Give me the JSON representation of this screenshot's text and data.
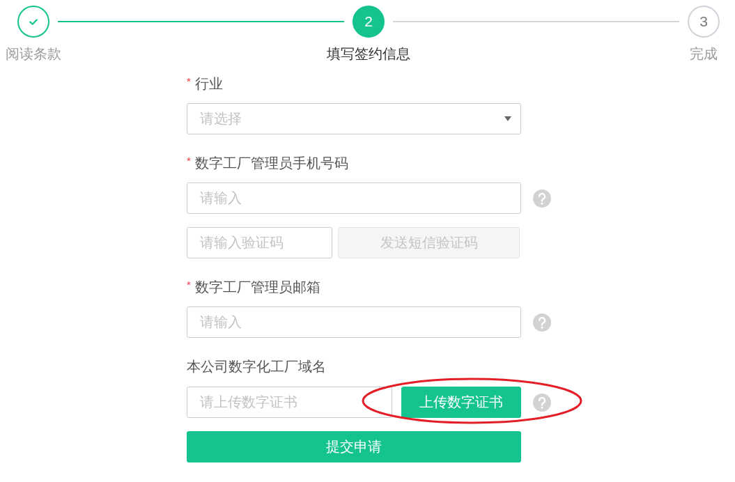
{
  "steps": [
    {
      "label": "阅读条款",
      "done": true,
      "selected": false
    },
    {
      "label": "填写签约信息",
      "number": "2",
      "done": false,
      "selected": true
    },
    {
      "label": "完成",
      "number": "3",
      "done": false,
      "selected": false
    }
  ],
  "form": {
    "fields": [
      {
        "kind": "select",
        "required_mark": "*",
        "label": "行业",
        "placeholder": "请选择"
      },
      {
        "kind": "input",
        "required_mark": "*",
        "label": "数字工厂管理员手机号码",
        "placeholder": "请输入",
        "help": true
      },
      {
        "kind": "code",
        "placeholder": "请输入验证码",
        "button": {
          "label": "发送短信验证码",
          "disabled": true
        }
      },
      {
        "kind": "input",
        "required_mark": "*",
        "label": "数字工厂管理员邮箱",
        "placeholder": "请输入",
        "help": true
      },
      {
        "kind": "upload",
        "label": "本公司数字化工厂域名",
        "placeholder": "请上传数字证书",
        "button": {
          "label": "上传数字证书",
          "disabled": false
        },
        "help": true,
        "circled": true
      }
    ],
    "submit": "提交申请"
  }
}
